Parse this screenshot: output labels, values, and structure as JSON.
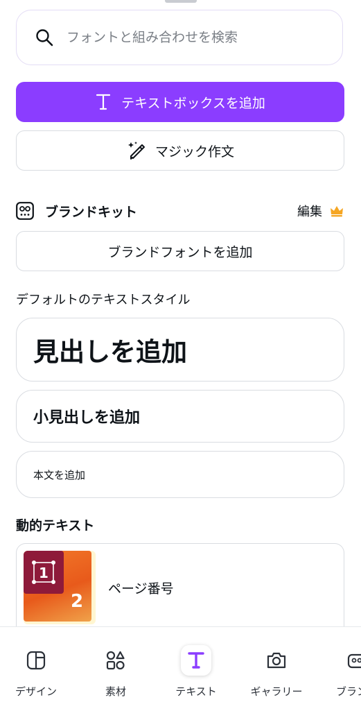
{
  "search": {
    "placeholder": "フォントと組み合わせを検索"
  },
  "actions": {
    "add_textbox": "テキストボックスを追加",
    "magic_write": "マジック作文"
  },
  "brand_kit": {
    "title": "ブランドキット",
    "edit": "編集",
    "add_brand_font": "ブランドフォントを追加"
  },
  "default_styles": {
    "label": "デフォルトのテキストスタイル",
    "heading": "見出しを追加",
    "subheading": "小見出しを追加",
    "body": "本文を追加"
  },
  "dynamic_text": {
    "label": "動的テキスト",
    "items": [
      {
        "label": "ページ番号",
        "thumb_front": "1",
        "thumb_back": "2"
      }
    ]
  },
  "tabs": [
    {
      "label": "デザイン",
      "icon": "layout-icon"
    },
    {
      "label": "素材",
      "icon": "elements-icon"
    },
    {
      "label": "テキスト",
      "icon": "text-icon",
      "active": true
    },
    {
      "label": "ギャラリー",
      "icon": "camera-icon"
    },
    {
      "label": "ブランド",
      "icon": "brand-icon"
    }
  ],
  "colors": {
    "accent": "#8b3dff",
    "crown": "#f5a623",
    "thumb_dark": "#8e1a3a",
    "thumb_orange": "#e85a1b"
  }
}
